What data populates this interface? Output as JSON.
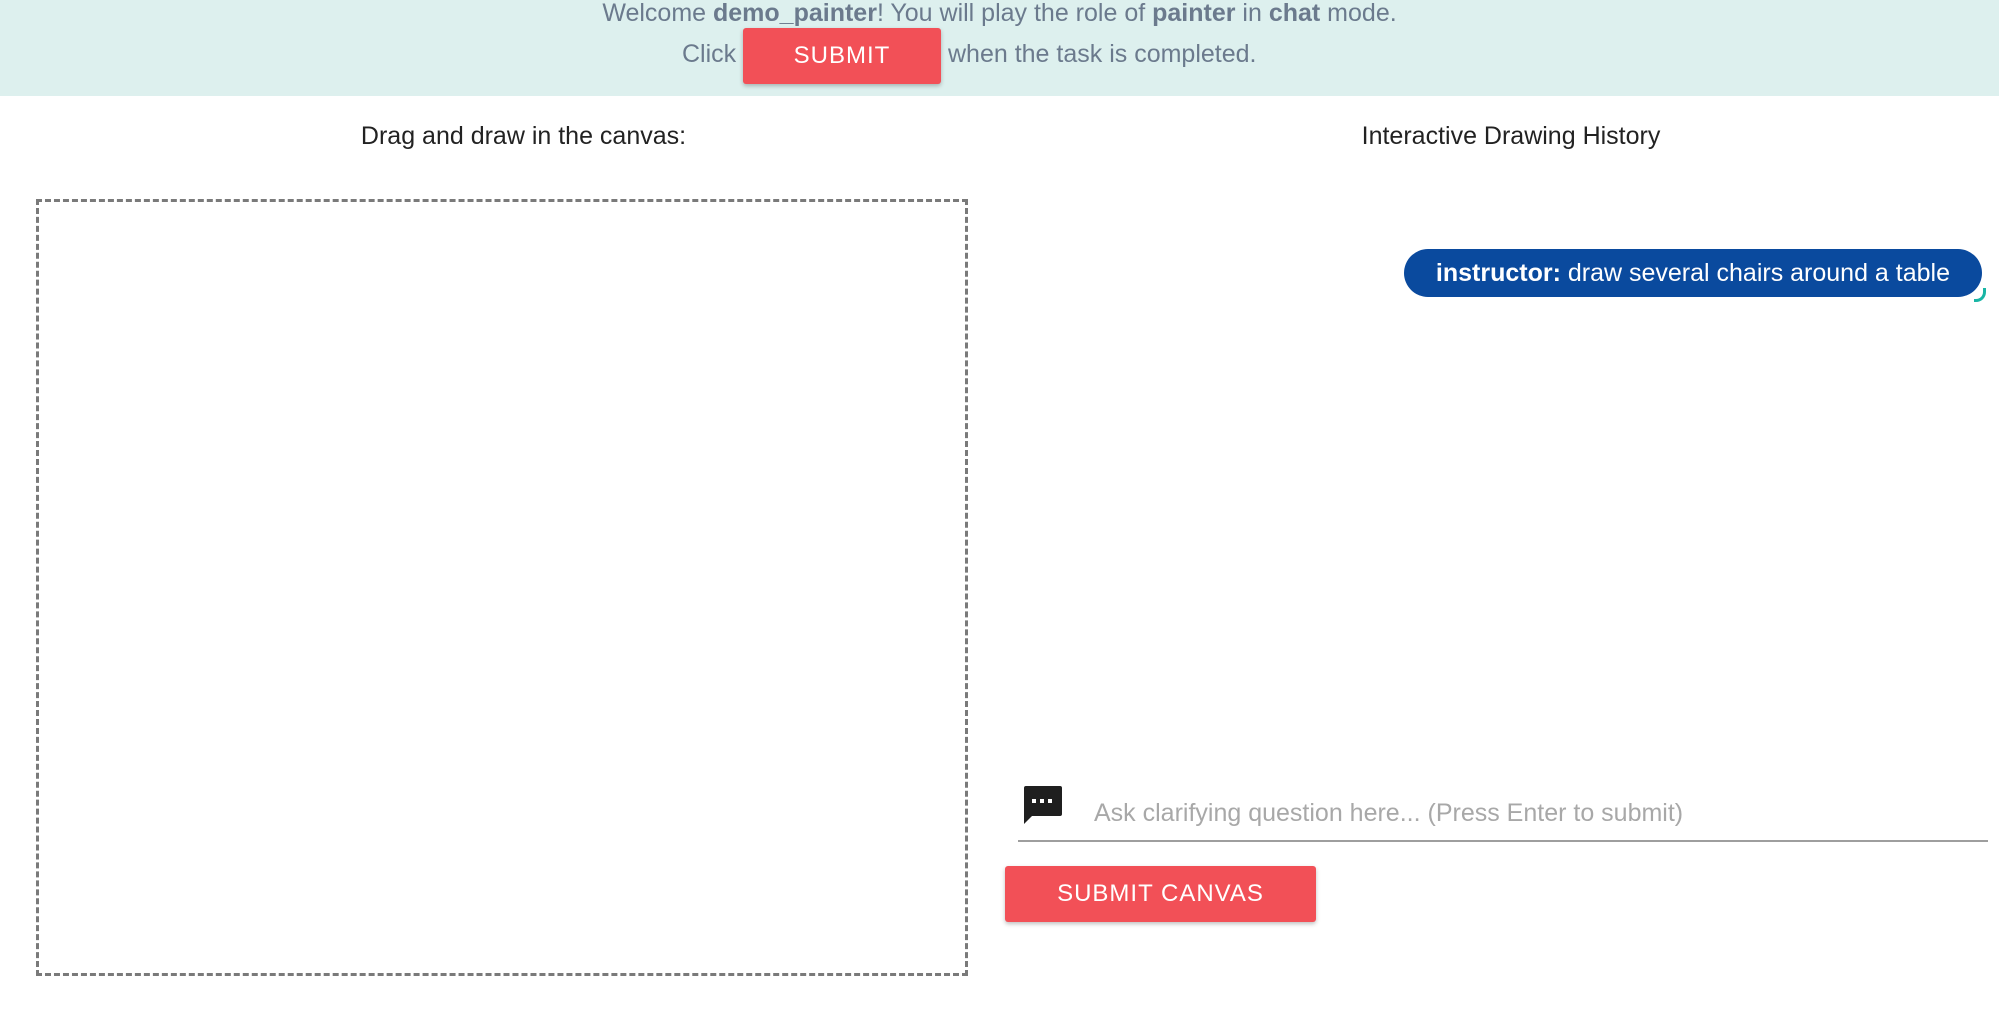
{
  "banner": {
    "welcome_prefix": "Welcome ",
    "username": "demo_painter",
    "role_prefix": "! You will play the role of ",
    "role": "painter",
    "mode_prefix": " in ",
    "mode": "chat",
    "mode_suffix": " mode.",
    "click_text": "Click",
    "submit_label": "SUBMIT",
    "completion_text": "when the task is completed.",
    "background_color": "#ddf0ee",
    "text_color": "#6b7a8d"
  },
  "canvas_panel": {
    "heading": "Drag and draw in the canvas:"
  },
  "history_panel": {
    "heading": "Interactive Drawing History",
    "messages": [
      {
        "speaker": "instructor:",
        "text": " draw several chairs around a table",
        "bubble_color": "#0a4a9e"
      }
    ]
  },
  "question_input": {
    "icon": "chat-bubble-icon",
    "placeholder": "Ask clarifying question here... (Press Enter to submit)",
    "value": ""
  },
  "submit_canvas_label": "SUBMIT CANVAS",
  "accent_color": "#f25057"
}
